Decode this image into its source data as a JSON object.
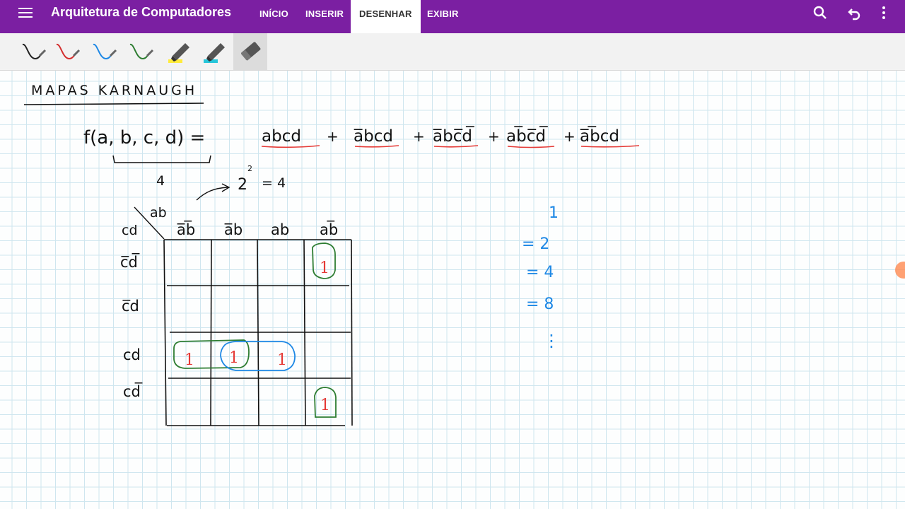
{
  "app": {
    "title": "Arquitetura de Computadores",
    "accent_color": "#7b1fa2"
  },
  "menu": {
    "tabs": [
      {
        "label": "INÍCIO"
      },
      {
        "label": "INSERIR"
      },
      {
        "label": "DESENHAR"
      },
      {
        "label": "EXIBIR"
      }
    ],
    "active_tab": "DESENHAR"
  },
  "topbar_icons": [
    "hamburger-menu-icon",
    "search-icon",
    "undo-icon",
    "more-vert-icon"
  ],
  "draw_tools": [
    {
      "name": "pen-black-icon",
      "color": "#222222"
    },
    {
      "name": "pen-red-icon",
      "color": "#d32f2f"
    },
    {
      "name": "pen-blue-icon",
      "color": "#1e88e5"
    },
    {
      "name": "pen-green-icon",
      "color": "#2e7d32"
    },
    {
      "name": "highlighter-yellow-icon",
      "color": "#ffeb3b"
    },
    {
      "name": "highlighter-cyan-icon",
      "color": "#26c6da"
    },
    {
      "name": "eraser-icon",
      "color": "#555555",
      "selected": true
    }
  ],
  "note": {
    "title": "MAPAS KARNAUGH",
    "function_lhs": "f(a, b, c, d) =",
    "terms": [
      "abcd",
      "a̅bcd",
      "a̅bc̅d̅",
      "ab̅c̅d̅",
      "a̅b̅cd"
    ],
    "variable_count": "4",
    "power_label": "2",
    "power_exponent": "2",
    "power_result": "= 4",
    "kmap": {
      "corner_top": "ab",
      "corner_left": "cd",
      "col_headers": [
        "a̅b̅",
        "a̅b",
        "ab",
        "ab̅"
      ],
      "row_headers": [
        "c̅d̅",
        "c̅d",
        "cd",
        "cd̅"
      ],
      "ones_mark": "1"
    },
    "side_column": [
      "1",
      "= 2",
      "= 4",
      "= 8",
      "⋮"
    ]
  }
}
